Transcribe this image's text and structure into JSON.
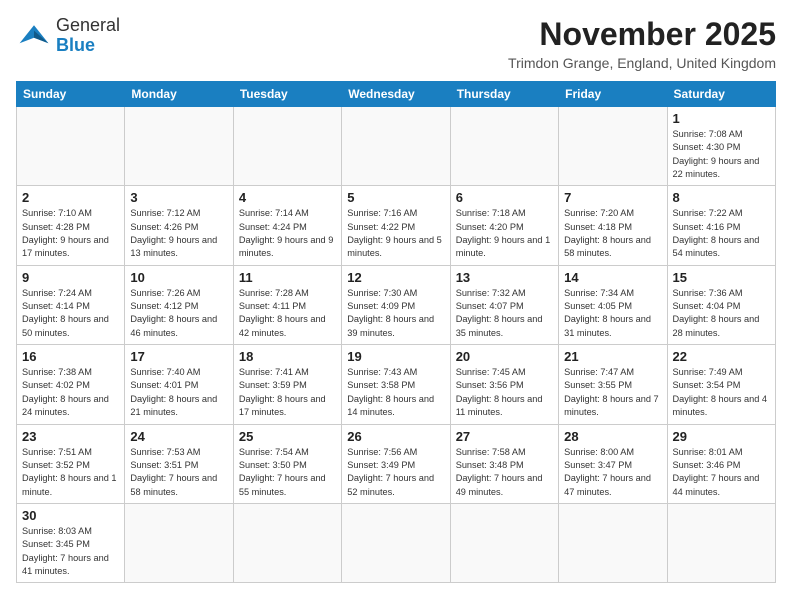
{
  "header": {
    "logo_general": "General",
    "logo_blue": "Blue",
    "title": "November 2025",
    "location": "Trimdon Grange, England, United Kingdom"
  },
  "days_of_week": [
    "Sunday",
    "Monday",
    "Tuesday",
    "Wednesday",
    "Thursday",
    "Friday",
    "Saturday"
  ],
  "weeks": [
    [
      {
        "day": "",
        "info": ""
      },
      {
        "day": "",
        "info": ""
      },
      {
        "day": "",
        "info": ""
      },
      {
        "day": "",
        "info": ""
      },
      {
        "day": "",
        "info": ""
      },
      {
        "day": "",
        "info": ""
      },
      {
        "day": "1",
        "info": "Sunrise: 7:08 AM\nSunset: 4:30 PM\nDaylight: 9 hours\nand 22 minutes."
      }
    ],
    [
      {
        "day": "2",
        "info": "Sunrise: 7:10 AM\nSunset: 4:28 PM\nDaylight: 9 hours\nand 17 minutes."
      },
      {
        "day": "3",
        "info": "Sunrise: 7:12 AM\nSunset: 4:26 PM\nDaylight: 9 hours\nand 13 minutes."
      },
      {
        "day": "4",
        "info": "Sunrise: 7:14 AM\nSunset: 4:24 PM\nDaylight: 9 hours\nand 9 minutes."
      },
      {
        "day": "5",
        "info": "Sunrise: 7:16 AM\nSunset: 4:22 PM\nDaylight: 9 hours\nand 5 minutes."
      },
      {
        "day": "6",
        "info": "Sunrise: 7:18 AM\nSunset: 4:20 PM\nDaylight: 9 hours\nand 1 minute."
      },
      {
        "day": "7",
        "info": "Sunrise: 7:20 AM\nSunset: 4:18 PM\nDaylight: 8 hours\nand 58 minutes."
      },
      {
        "day": "8",
        "info": "Sunrise: 7:22 AM\nSunset: 4:16 PM\nDaylight: 8 hours\nand 54 minutes."
      }
    ],
    [
      {
        "day": "9",
        "info": "Sunrise: 7:24 AM\nSunset: 4:14 PM\nDaylight: 8 hours\nand 50 minutes."
      },
      {
        "day": "10",
        "info": "Sunrise: 7:26 AM\nSunset: 4:12 PM\nDaylight: 8 hours\nand 46 minutes."
      },
      {
        "day": "11",
        "info": "Sunrise: 7:28 AM\nSunset: 4:11 PM\nDaylight: 8 hours\nand 42 minutes."
      },
      {
        "day": "12",
        "info": "Sunrise: 7:30 AM\nSunset: 4:09 PM\nDaylight: 8 hours\nand 39 minutes."
      },
      {
        "day": "13",
        "info": "Sunrise: 7:32 AM\nSunset: 4:07 PM\nDaylight: 8 hours\nand 35 minutes."
      },
      {
        "day": "14",
        "info": "Sunrise: 7:34 AM\nSunset: 4:05 PM\nDaylight: 8 hours\nand 31 minutes."
      },
      {
        "day": "15",
        "info": "Sunrise: 7:36 AM\nSunset: 4:04 PM\nDaylight: 8 hours\nand 28 minutes."
      }
    ],
    [
      {
        "day": "16",
        "info": "Sunrise: 7:38 AM\nSunset: 4:02 PM\nDaylight: 8 hours\nand 24 minutes."
      },
      {
        "day": "17",
        "info": "Sunrise: 7:40 AM\nSunset: 4:01 PM\nDaylight: 8 hours\nand 21 minutes."
      },
      {
        "day": "18",
        "info": "Sunrise: 7:41 AM\nSunset: 3:59 PM\nDaylight: 8 hours\nand 17 minutes."
      },
      {
        "day": "19",
        "info": "Sunrise: 7:43 AM\nSunset: 3:58 PM\nDaylight: 8 hours\nand 14 minutes."
      },
      {
        "day": "20",
        "info": "Sunrise: 7:45 AM\nSunset: 3:56 PM\nDaylight: 8 hours\nand 11 minutes."
      },
      {
        "day": "21",
        "info": "Sunrise: 7:47 AM\nSunset: 3:55 PM\nDaylight: 8 hours\nand 7 minutes."
      },
      {
        "day": "22",
        "info": "Sunrise: 7:49 AM\nSunset: 3:54 PM\nDaylight: 8 hours\nand 4 minutes."
      }
    ],
    [
      {
        "day": "23",
        "info": "Sunrise: 7:51 AM\nSunset: 3:52 PM\nDaylight: 8 hours\nand 1 minute."
      },
      {
        "day": "24",
        "info": "Sunrise: 7:53 AM\nSunset: 3:51 PM\nDaylight: 7 hours\nand 58 minutes."
      },
      {
        "day": "25",
        "info": "Sunrise: 7:54 AM\nSunset: 3:50 PM\nDaylight: 7 hours\nand 55 minutes."
      },
      {
        "day": "26",
        "info": "Sunrise: 7:56 AM\nSunset: 3:49 PM\nDaylight: 7 hours\nand 52 minutes."
      },
      {
        "day": "27",
        "info": "Sunrise: 7:58 AM\nSunset: 3:48 PM\nDaylight: 7 hours\nand 49 minutes."
      },
      {
        "day": "28",
        "info": "Sunrise: 8:00 AM\nSunset: 3:47 PM\nDaylight: 7 hours\nand 47 minutes."
      },
      {
        "day": "29",
        "info": "Sunrise: 8:01 AM\nSunset: 3:46 PM\nDaylight: 7 hours\nand 44 minutes."
      }
    ],
    [
      {
        "day": "30",
        "info": "Sunrise: 8:03 AM\nSunset: 3:45 PM\nDaylight: 7 hours\nand 41 minutes."
      },
      {
        "day": "",
        "info": ""
      },
      {
        "day": "",
        "info": ""
      },
      {
        "day": "",
        "info": ""
      },
      {
        "day": "",
        "info": ""
      },
      {
        "day": "",
        "info": ""
      },
      {
        "day": "",
        "info": ""
      }
    ]
  ]
}
